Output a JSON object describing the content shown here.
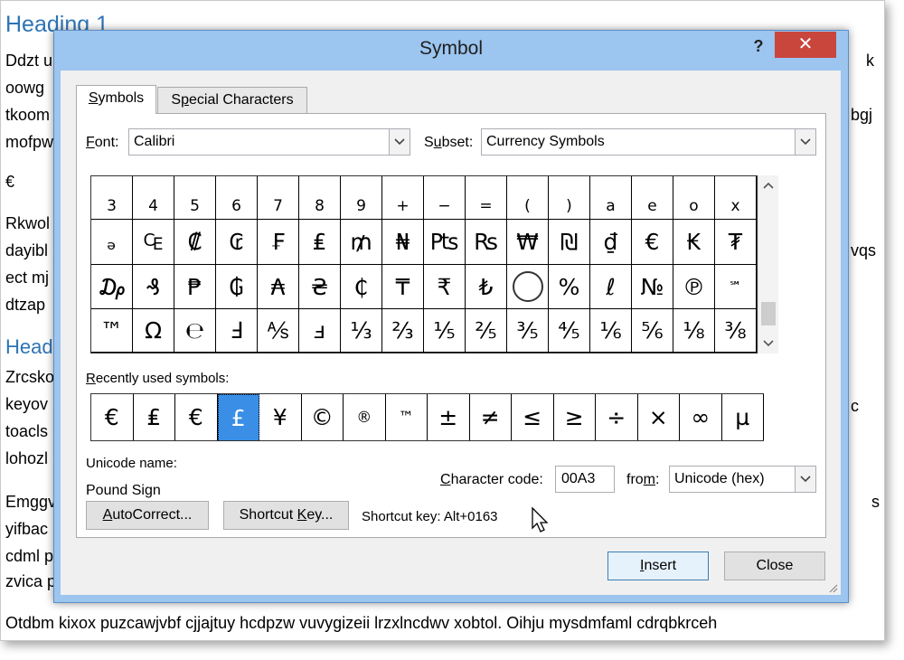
{
  "document": {
    "heading1": "Heading 1",
    "heading2": "Head",
    "lines_left": [
      "Ddzt u",
      "oowg",
      "tkoom",
      "mofpw",
      "€",
      "Rkwol",
      "dayibl",
      "ect mj",
      "dtzap",
      "Zrcsko",
      "keyov",
      "toacls",
      "lohozl",
      "Emggv",
      "yifbac",
      "cdml p",
      "zvica p"
    ],
    "lines_right": [
      "k",
      "bgj",
      "vqs",
      "c",
      "s"
    ],
    "bottom_line": "Otdbm kixox puzcawjvbf cjjajtuy hcdpzw vuvygizeii lrzxlncdwv xobtol. Oihju mysdmfaml cdrqbkrceh"
  },
  "dialog": {
    "title": "Symbol",
    "help_label": "?",
    "close_glyph": "✕",
    "tabs": {
      "symbols": {
        "pre": "",
        "key": "S",
        "post": "ymbols"
      },
      "special": {
        "pre": "S",
        "key": "p",
        "post": "ecial Characters"
      }
    },
    "font_label": {
      "key": "F",
      "post": "ont:"
    },
    "font_value": "Calibri",
    "subset_label": {
      "pre": "S",
      "key": "u",
      "post": "bset:"
    },
    "subset_value": "Currency Symbols",
    "grid_rows": [
      [
        "3",
        "4",
        "5",
        "6",
        "7",
        "8",
        "9",
        "+",
        "−",
        "=",
        "(",
        ")",
        "a",
        "e",
        "o",
        "x"
      ],
      [
        "ₔ",
        "₠",
        "₡",
        "₢",
        "₣",
        "₤",
        "₥",
        "₦",
        "₧",
        "₨",
        "₩",
        "₪",
        "₫",
        "€",
        "₭",
        "₮"
      ],
      [
        "₯",
        "₰",
        "₱",
        "₲",
        "₳",
        "₴",
        "₵",
        "₸",
        "₹",
        "₺",
        "◯",
        "%",
        "ℓ",
        "№",
        "℗",
        "℠"
      ],
      [
        "™",
        "Ω",
        "℮",
        "Ⅎ",
        "⅍",
        "ⅎ",
        "⅓",
        "⅔",
        "⅕",
        "⅖",
        "⅗",
        "⅘",
        "⅙",
        "⅚",
        "⅛",
        "⅜"
      ]
    ],
    "recent_label": {
      "key": "R",
      "post": "ecently used symbols:"
    },
    "recent_symbols": [
      "€",
      "₤",
      "€",
      "£",
      "¥",
      "©",
      "®",
      "™",
      "±",
      "≠",
      "≤",
      "≥",
      "÷",
      "×",
      "∞",
      "µ"
    ],
    "unicode_name_label": "Unicode name:",
    "unicode_name_value": "Pound Sign",
    "char_code_label": {
      "key": "C",
      "post": "haracter code:"
    },
    "char_code_value": "00A3",
    "from_label": {
      "pre": "fro",
      "key": "m",
      "post": ":"
    },
    "from_value": "Unicode (hex)",
    "autocorrect_btn": {
      "key": "A",
      "post": "utoCorrect..."
    },
    "shortcut_btn": {
      "pre": "Shortcut ",
      "key": "K",
      "post": "ey..."
    },
    "shortcut_key_text": "Shortcut key: Alt+0163",
    "insert_btn": {
      "key": "I",
      "post": "nsert"
    },
    "close_btn": "Close"
  },
  "colors": {
    "selected": "#3a8ee6",
    "dialog_frame": "#9cc5ef",
    "close_red": "#c9463d",
    "heading_blue": "#2e74b5"
  }
}
